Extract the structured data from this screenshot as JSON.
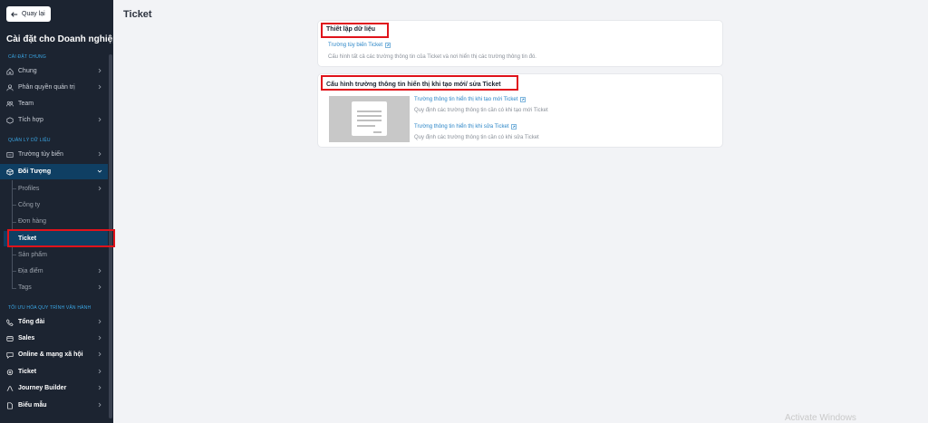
{
  "sidebar": {
    "back_label": "Quay lại",
    "title": "Cài đặt cho Doanh nghiệp",
    "sections": {
      "general": "CÀI ĐẶT CHUNG",
      "data": "QUẢN LÝ DỮ LIỆU",
      "optimize": "TỐI ƯU HÓA QUY TRÌNH VẬN HÀNH"
    },
    "general_items": [
      "Chung",
      "Phân quyền quản trị",
      "Team",
      "Tích hợp"
    ],
    "data_items": [
      "Trường tùy biến",
      "Đối Tượng"
    ],
    "object_subitems": [
      "Profiles",
      "Công ty",
      "Đơn hàng",
      "Ticket",
      "Sản phẩm",
      "Địa điểm",
      "Tags"
    ],
    "optimize_items": [
      "Tổng đài",
      "Sales",
      "Online & mạng xã hội",
      "Ticket",
      "Journey Builder",
      "Biểu mẫu"
    ]
  },
  "main": {
    "page_title": "Ticket",
    "card1": {
      "title": "Thiết lập dữ liệu",
      "link": "Trường tùy biến Ticket",
      "desc": "Cấu hình tất cả các trường thông tin của Ticket và nơi hiển thị các trường thông tin đó."
    },
    "card2": {
      "title": "Cấu hình trường thông tin hiển thị khi tạo mới/ sửa Ticket",
      "link1": "Trường thông tin hiển thị khi tạo mới Ticket",
      "desc1": "Quy định các trường thông tin cần có khi tạo mới Ticket",
      "link2": "Trường thông tin hiển thị khi sửa Ticket",
      "desc2": "Quy định các trường thông tin cần có khi sửa Ticket"
    }
  },
  "watermark": "Activate Windows",
  "colors": {
    "sidebar_bg": "#1c2431",
    "active_bg": "#0f3f63",
    "accent": "#2a85c7",
    "highlight": "#e0131b"
  }
}
